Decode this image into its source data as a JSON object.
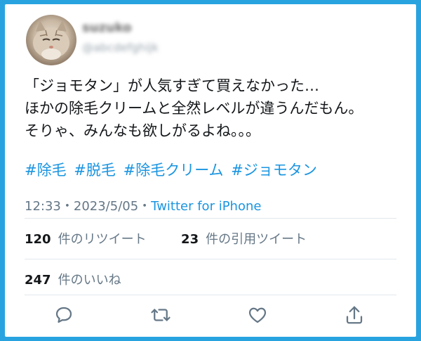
{
  "user": {
    "name": "suzuko",
    "handle": "@abcdefghijk"
  },
  "tweet": {
    "lines": [
      "「ジョモタン」が人気すぎて買えなかった…",
      "ほかの除毛クリームと全然レベルが違うんだもん。",
      "そりゃ、みんなも欲しがるよね。。。"
    ],
    "hashtags": [
      "#除毛",
      "#脱毛",
      "#除毛クリーム",
      "#ジョモタン"
    ]
  },
  "meta": {
    "time": "12:33",
    "date": "2023/5/05",
    "separator": "・",
    "source": "Twitter for iPhone"
  },
  "stats": {
    "retweets_count": "120",
    "retweets_label": "件のリツイート",
    "quotes_count": "23",
    "quotes_label": "件の引用ツイート",
    "likes_count": "247",
    "likes_label": "件のいいね"
  },
  "colors": {
    "background": "#29a3e0",
    "link": "#1b95e0",
    "text": "#14171a",
    "muted": "#657786"
  },
  "icons": [
    "reply-icon",
    "retweet-icon",
    "like-icon",
    "share-icon"
  ]
}
